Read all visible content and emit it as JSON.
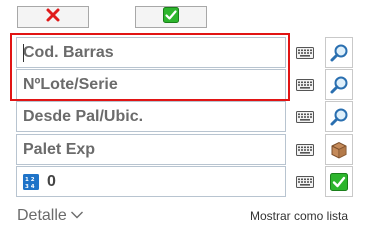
{
  "toolbar": {
    "cancel_icon": "red-x-icon",
    "confirm_icon": "green-check-icon",
    "cancel_color": "#e01b1b",
    "confirm_color": "#2db52d"
  },
  "fields": [
    {
      "placeholder": "Cod. Barras",
      "action_icon": "magnifier-icon"
    },
    {
      "placeholder": "NºLote/Serie",
      "action_icon": "magnifier-icon"
    },
    {
      "placeholder": "Desde Pal/Ubic.",
      "action_icon": "magnifier-icon"
    },
    {
      "placeholder": "Palet Exp",
      "action_icon": "box-icon"
    },
    {
      "value": "0",
      "action_icon": "green-check-icon"
    }
  ],
  "footer": {
    "detail_label": "Detalle",
    "list_toggle_label": "Mostrar como lista"
  },
  "colors": {
    "highlight": "#e11414",
    "field_border": "#b8c4d0"
  }
}
